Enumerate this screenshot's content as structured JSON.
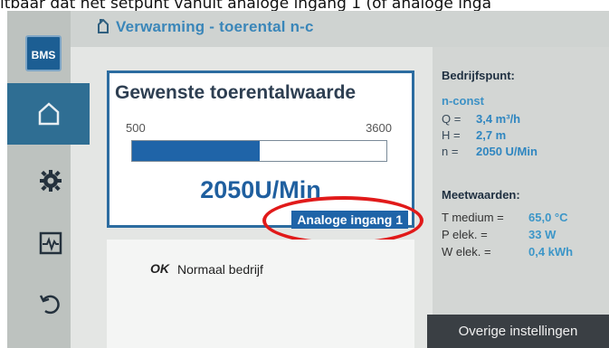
{
  "caption": "itbaar dat het setpunt vanuit analoge ingang 1 (of analoge inga",
  "header": {
    "title": "Verwarming - toerental n-c"
  },
  "sidebar": {
    "logo_label": "BMS",
    "items": [
      {
        "name": "home",
        "icon": "home-icon"
      },
      {
        "name": "settings",
        "icon": "gear-icon"
      },
      {
        "name": "diagnostics",
        "icon": "pulse-icon"
      },
      {
        "name": "restore",
        "icon": "undo-icon"
      }
    ]
  },
  "setpoint": {
    "title": "Gewenste toerentalwaarde",
    "min": "500",
    "max": "3600",
    "value_text": "2050U/Min",
    "bar_level": 0.5,
    "source_badge": "Analoge ingang 1"
  },
  "status": {
    "ok": "OK",
    "text": "Normaal bedrijf"
  },
  "operating_point": {
    "heading": "Bedrijfspunt:",
    "mode": "n-const",
    "rows": [
      {
        "label": "Q =",
        "value": "3,4 m³/h"
      },
      {
        "label": "H =",
        "value": "2,7 m"
      },
      {
        "label": "n =",
        "value": "2050 U/Min"
      }
    ]
  },
  "measurements": {
    "heading": "Meetwaarden:",
    "rows": [
      {
        "label": "T medium =",
        "value": "65,0 °C"
      },
      {
        "label": "P elek. =",
        "value": "33 W"
      },
      {
        "label": "W elek. =",
        "value": "0,4 kWh"
      }
    ]
  },
  "footer_button": "Overige instellingen",
  "colors": {
    "accent": "#1f64a8",
    "highlight": "#e11a1a",
    "active_nav": "#2f6e93"
  }
}
